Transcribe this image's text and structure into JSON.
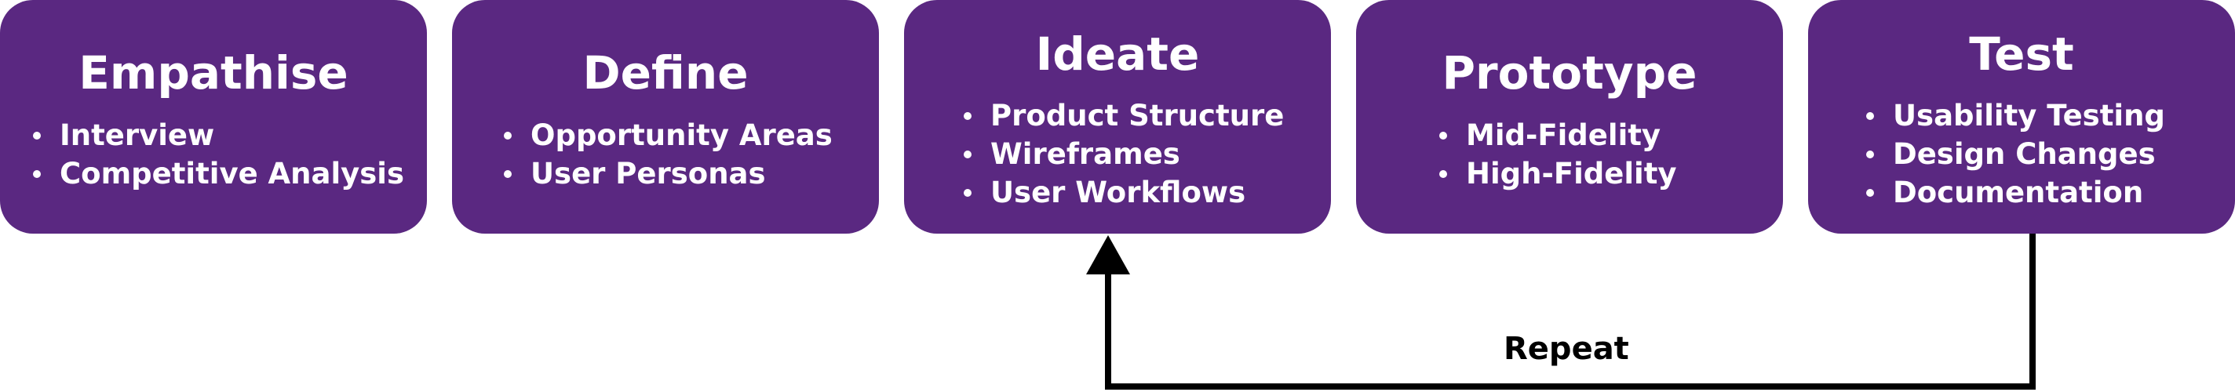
{
  "stages": [
    {
      "title": "Empathise",
      "items": [
        "Interview",
        "Competitive Analysis"
      ]
    },
    {
      "title": "Define",
      "items": [
        "Opportunity Areas",
        "User Personas"
      ]
    },
    {
      "title": "Ideate",
      "items": [
        "Product Structure",
        "Wireframes",
        "User Workflows"
      ]
    },
    {
      "title": "Prototype",
      "items": [
        "Mid-Fidelity",
        "High-Fidelity"
      ]
    },
    {
      "title": "Test",
      "items": [
        "Usability Testing",
        "Design Changes",
        "Documentation"
      ]
    }
  ],
  "loop": {
    "label": "Repeat",
    "from_stage": "Test",
    "to_stage": "Ideate"
  },
  "colors": {
    "card_fill": "#5a2881",
    "card_text": "#ffffff",
    "arrow": "#000000",
    "background": "#ffffff"
  }
}
